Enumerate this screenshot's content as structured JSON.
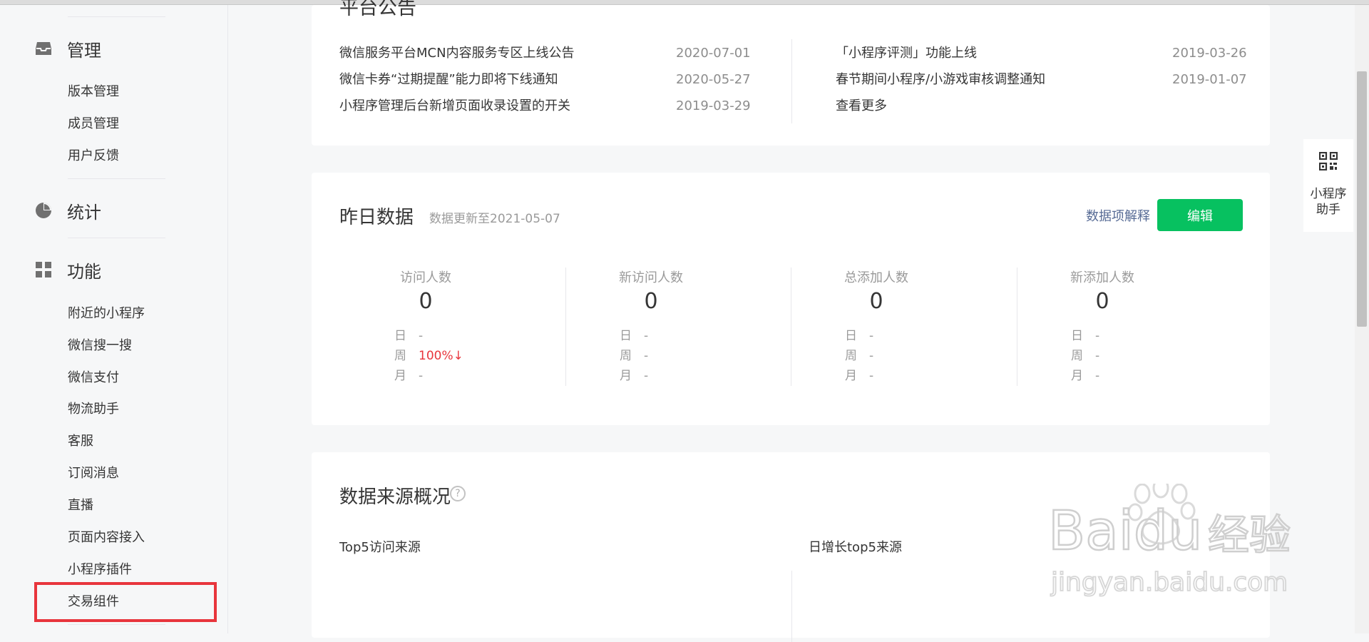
{
  "sidebar": {
    "groups": [
      {
        "label": "管理",
        "icon": "inbox-icon"
      },
      {
        "label": "统计",
        "icon": "pie-chart-icon"
      },
      {
        "label": "功能",
        "icon": "grid-icon"
      }
    ],
    "manage_items": [
      "版本管理",
      "成员管理",
      "用户反馈"
    ],
    "feature_items": [
      "附近的小程序",
      "微信搜一搜",
      "微信支付",
      "物流助手",
      "客服",
      "订阅消息",
      "直播",
      "页面内容接入",
      "小程序插件",
      "交易组件"
    ],
    "highlight_color": "#e8353c"
  },
  "notice": {
    "title": "平台公告",
    "left": [
      {
        "title": "微信服务平台MCN内容服务专区上线公告",
        "date": "2020-07-01"
      },
      {
        "title": "微信卡券“过期提醒”能力即将下线通知",
        "date": "2020-05-27"
      },
      {
        "title": "小程序管理后台新增页面收录设置的开关",
        "date": "2019-03-29"
      }
    ],
    "right": [
      {
        "title": "「小程序评测」功能上线",
        "date": "2019-03-26"
      },
      {
        "title": "春节期间小程序/小游戏审核调整通知",
        "date": "2019-01-07"
      }
    ],
    "more_label": "查看更多"
  },
  "yesterday": {
    "title": "昨日数据",
    "subtitle": "数据更新至2021-05-07",
    "explain_label": "数据项解释",
    "edit_label": "编辑",
    "row_labels": [
      "日",
      "周",
      "月"
    ],
    "metrics": [
      {
        "label": "访问人数",
        "value": "0",
        "day": "-",
        "week": "100%↓",
        "month": "-"
      },
      {
        "label": "新访问人数",
        "value": "0",
        "day": "-",
        "week": "-",
        "month": "-"
      },
      {
        "label": "总添加人数",
        "value": "0",
        "day": "-",
        "week": "-",
        "month": "-"
      },
      {
        "label": "新添加人数",
        "value": "0",
        "day": "-",
        "week": "-",
        "month": "-"
      }
    ]
  },
  "source": {
    "title": "数据来源概况",
    "help_icon": "help-icon",
    "help_glyph": "?",
    "top5_label": "Top5访问来源",
    "growth_label": "日增长top5来源"
  },
  "helper": {
    "line1": "小程序",
    "line2": "助手",
    "icon": "qr-code-icon"
  },
  "watermark": {
    "brand": "Baidu",
    "brand_cn": "经验",
    "url": "jingyan.baidu.com"
  },
  "colors": {
    "primary_green": "#07c160",
    "link_blue": "#576b95",
    "decline_red": "#e8353c"
  }
}
